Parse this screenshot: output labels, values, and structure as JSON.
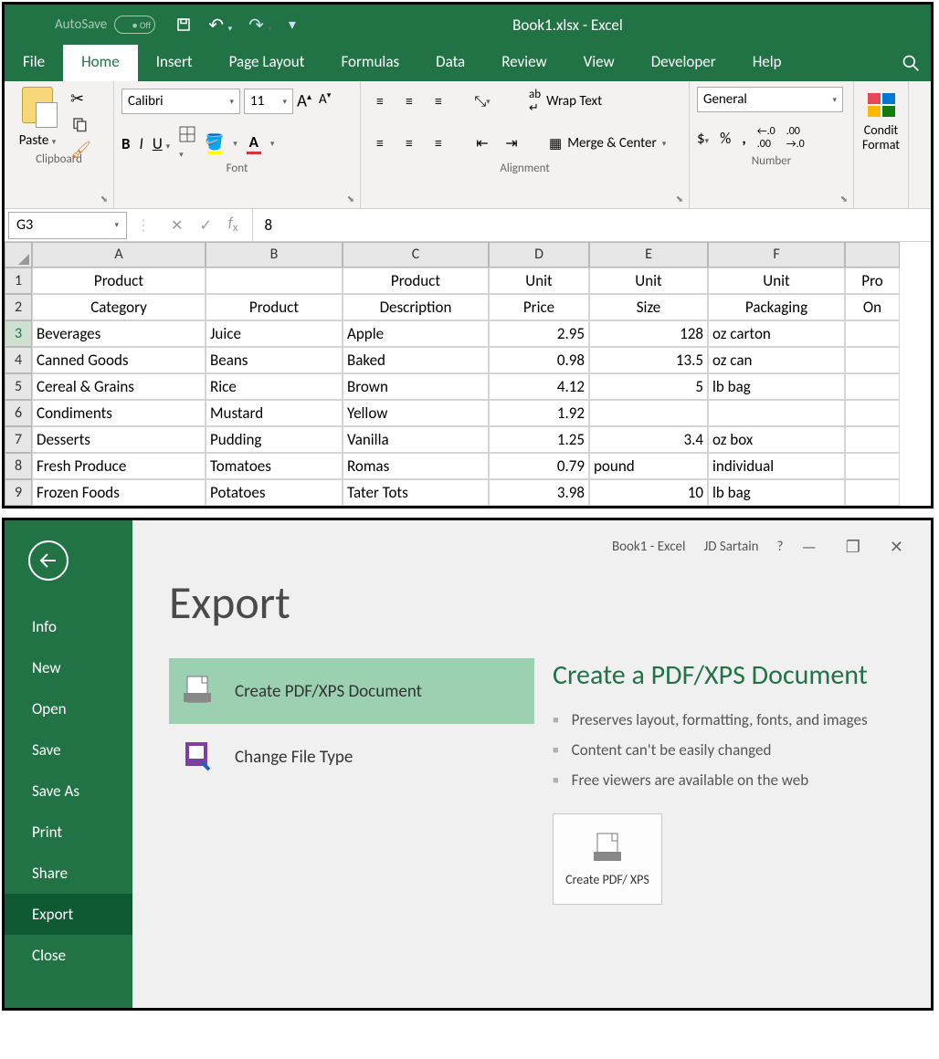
{
  "top": {
    "autosave_label": "AutoSave",
    "autosave_state": "Off",
    "title": "Book1.xlsx  -  Excel",
    "tabs": [
      "File",
      "Home",
      "Insert",
      "Page Layout",
      "Formulas",
      "Data",
      "Review",
      "View",
      "Developer",
      "Help"
    ],
    "active_tab": "Home",
    "ribbon": {
      "paste": "Paste",
      "clipboard": "Clipboard",
      "font_name": "Calibri",
      "font_size": "11",
      "font_group": "Font",
      "wrap": "Wrap Text",
      "merge": "Merge & Center",
      "align_group": "Alignment",
      "num_format": "General",
      "num_group": "Number",
      "cf": "Conditional Formatting"
    },
    "name_box": "G3",
    "formula_value": "8",
    "columns": [
      "A",
      "B",
      "C",
      "D",
      "E",
      "F"
    ],
    "col_g_partial": "Pro",
    "header1": [
      "Product",
      "",
      "Product",
      "Unit",
      "Unit",
      "Unit"
    ],
    "header2": [
      "Category",
      "Product",
      "Description",
      "Price",
      "Size",
      "Packaging"
    ],
    "header2_g": "On",
    "rows": [
      {
        "n": "3",
        "a": "Beverages",
        "b": "Juice",
        "c": "Apple",
        "d": "2.95",
        "e": "128",
        "f": "oz carton"
      },
      {
        "n": "4",
        "a": "Canned Goods",
        "b": "Beans",
        "c": "Baked",
        "d": "0.98",
        "e": "13.5",
        "f": "oz can"
      },
      {
        "n": "5",
        "a": "Cereal & Grains",
        "b": "Rice",
        "c": "Brown",
        "d": "4.12",
        "e": "5",
        "f": "lb bag"
      },
      {
        "n": "6",
        "a": "Condiments",
        "b": "Mustard",
        "c": "Yellow",
        "d": "1.92",
        "e": "",
        "f": ""
      },
      {
        "n": "7",
        "a": "Desserts",
        "b": "Pudding",
        "c": "Vanilla",
        "d": "1.25",
        "e": "3.4",
        "f": "oz box"
      },
      {
        "n": "8",
        "a": "Fresh Produce",
        "b": "Tomatoes",
        "c": "Romas",
        "d": "0.79",
        "e": "pound",
        "f": "individual"
      },
      {
        "n": "9",
        "a": "Frozen Foods",
        "b": "Potatoes",
        "c": "Tater Tots",
        "d": "3.98",
        "e": "10",
        "f": "lb bag"
      }
    ]
  },
  "backstage": {
    "title_doc": "Book1  -  Excel",
    "user": "JD Sartain",
    "sidebar": [
      "Info",
      "New",
      "Open",
      "Save",
      "Save As",
      "Print",
      "Share",
      "Export",
      "Close"
    ],
    "active_sidebar": "Export",
    "h1": "Export",
    "options": [
      {
        "label": "Create PDF/XPS Document",
        "icon": "pdf"
      },
      {
        "label": "Change File Type",
        "icon": "filetype"
      }
    ],
    "right_h2": "Create a PDF/XPS Document",
    "bullets": [
      "Preserves layout, formatting, fonts, and images",
      "Content can't be easily changed",
      "Free viewers are available on the web"
    ],
    "create_btn": "Create PDF/ XPS"
  }
}
